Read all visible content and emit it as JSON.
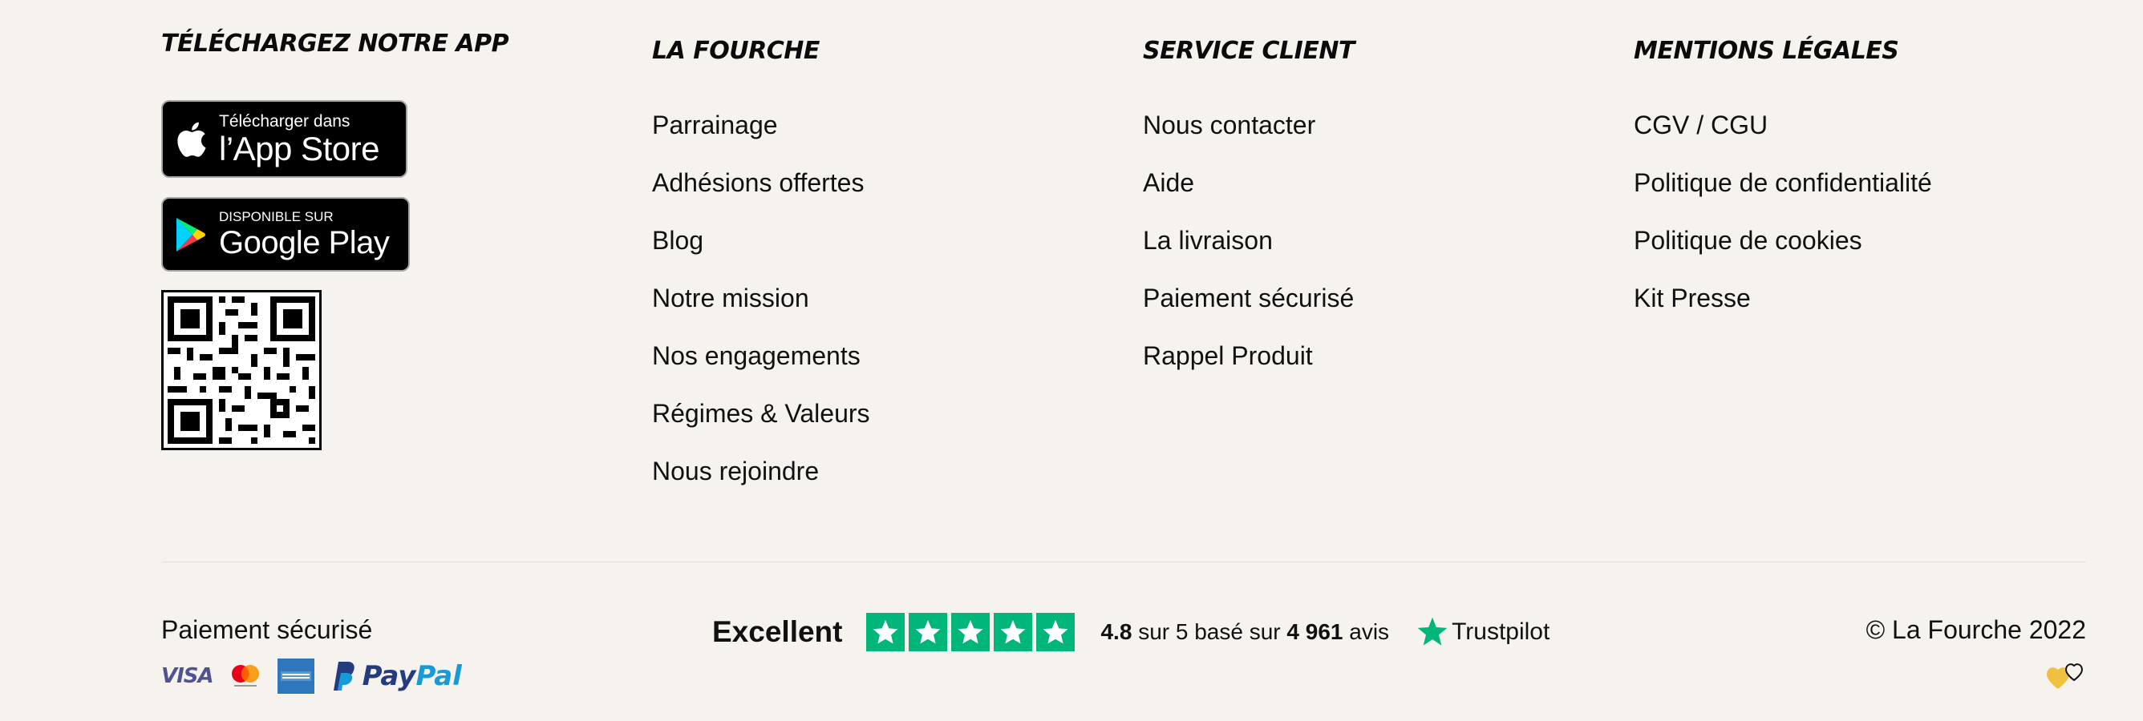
{
  "app_section": {
    "title": "TÉLÉCHARGEZ NOTRE APP",
    "appstore": {
      "small": "Télécharger dans",
      "big": "l’App Store"
    },
    "googleplay": {
      "small": "DISPONIBLE SUR",
      "big": "Google Play"
    }
  },
  "la_fourche": {
    "title": "LA FOURCHE",
    "links": [
      "Parrainage",
      "Adhésions offertes",
      "Blog",
      "Notre mission",
      "Nos engagements",
      "Régimes & Valeurs",
      "Nous rejoindre"
    ]
  },
  "service_client": {
    "title": "SERVICE CLIENT",
    "links": [
      "Nous contacter",
      "Aide",
      "La livraison",
      "Paiement sécurisé",
      "Rappel Produit"
    ]
  },
  "mentions_legales": {
    "title": "MENTIONS LÉGALES",
    "links": [
      "CGV / CGU",
      "Politique de confidentialité",
      "Politique de cookies",
      "Kit Presse"
    ]
  },
  "payment": {
    "title": "Paiement sécurisé",
    "visa": "VISA",
    "paypal_a": "Pay",
    "paypal_b": "Pal",
    "icons": [
      "visa-icon",
      "mastercard-icon",
      "amex-icon",
      "paypal-icon"
    ]
  },
  "trustpilot": {
    "rating_word": "Excellent",
    "score": "4.8",
    "score_mid": " sur 5 basé sur ",
    "count": "4 961",
    "count_suffix": " avis",
    "brand": "Trustpilot",
    "stars": 5,
    "color": "#00b67a"
  },
  "copyright": "© La Fourche 2022",
  "colors": {
    "background": "#f6f2ee",
    "text": "#111111",
    "accent_heart": "#f0c040"
  }
}
